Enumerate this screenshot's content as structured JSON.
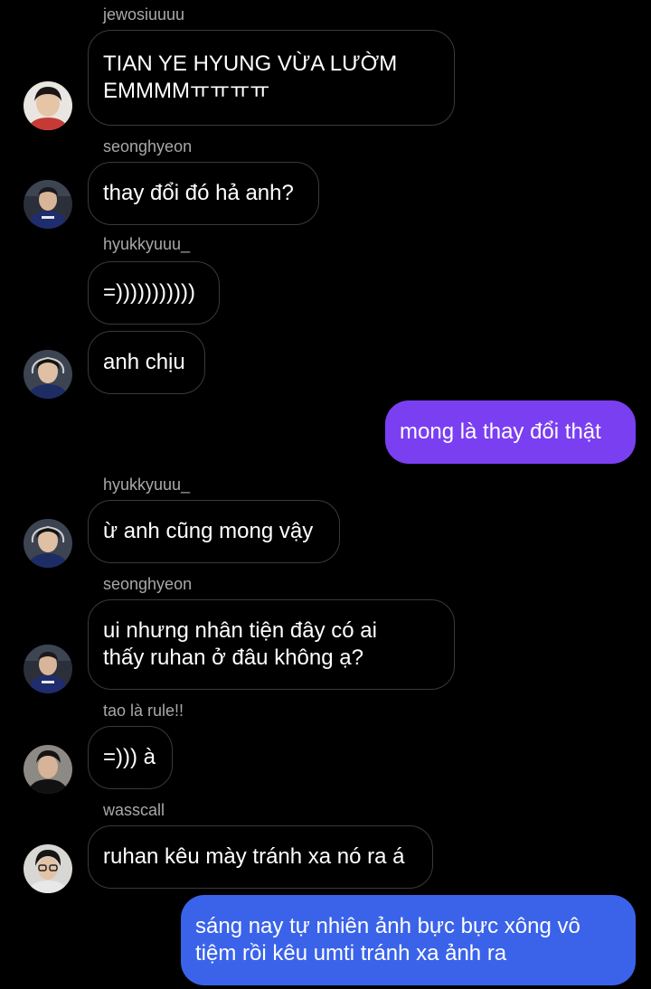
{
  "colors": {
    "background": "#000000",
    "received_border": "#3a3a3a",
    "sender_name": "#a8a8a8",
    "sent_purple": "#7b3ff2",
    "sent_blue": "#3a63ea"
  },
  "messages": [
    {
      "sender": "jewosiuuuu",
      "text": "TIAN YE HYUNG VỪA LƯỜM\nEMMMMㅠㅠㅠㅠ",
      "avatar": "avatar-jewosiuuuu"
    },
    {
      "sender": "seonghyeon",
      "text": "thay đổi đó hả anh?",
      "avatar": "avatar-seonghyeon"
    },
    {
      "sender": "hyukkyuuu_",
      "text": "=)))))))))))"
    },
    {
      "text": "anh chịu",
      "avatar": "avatar-hyukkyuuu"
    },
    {
      "text": "mong là thay đổi thật",
      "outgoing": true
    },
    {
      "sender": "hyukkyuuu_",
      "text": "ừ anh cũng mong vậy",
      "avatar": "avatar-hyukkyuuu"
    },
    {
      "sender": "seonghyeon",
      "text": "ui nhưng nhân tiện đây có ai\nthấy ruhan ở đâu không ạ?",
      "avatar": "avatar-seonghyeon"
    },
    {
      "sender": "tao là rule!!",
      "text": "=))) à",
      "avatar": "avatar-tao-la-rule"
    },
    {
      "sender": "wasscall",
      "text": "ruhan kêu mày tránh xa nó ra á",
      "avatar": "avatar-wasscall"
    },
    {
      "text": "sáng nay tự nhiên ảnh bực bực xông vô\ntiệm rồi kêu umti tránh xa ảnh ra",
      "outgoing": true
    }
  ]
}
